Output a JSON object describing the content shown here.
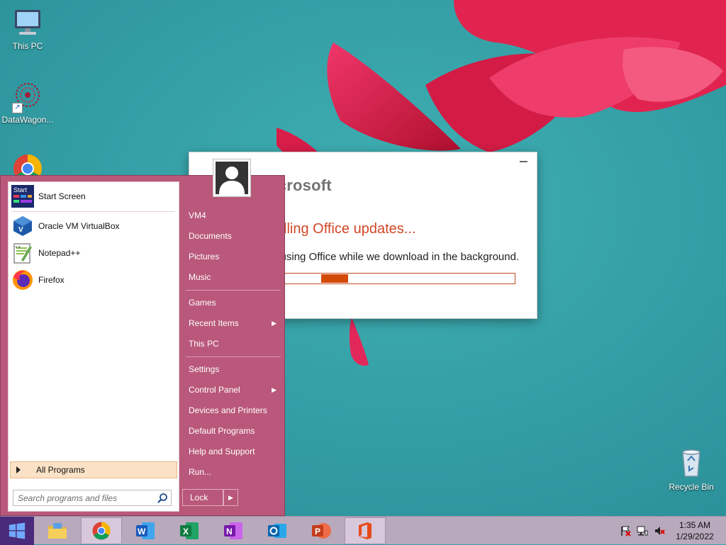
{
  "desktop": {
    "icons": [
      {
        "label": "This PC"
      },
      {
        "label": "DataWagon..."
      },
      {
        "label": "Recycle Bin"
      }
    ]
  },
  "office_dialog": {
    "brand": "Microsoft",
    "title": "We're installing Office updates...",
    "message": "You can keep using Office while we download in the background.",
    "progress_fraction": 0.09,
    "accent_color": "#d24726"
  },
  "start_menu": {
    "programs": [
      {
        "label": "Start Screen",
        "icon": "start-screen-icon"
      },
      {
        "label": "Oracle VM VirtualBox",
        "icon": "virtualbox-icon"
      },
      {
        "label": "Notepad++",
        "icon": "notepad-plus-plus-icon"
      },
      {
        "label": "Firefox",
        "icon": "firefox-icon"
      }
    ],
    "all_programs_label": "All Programs",
    "search_placeholder": "Search programs and files",
    "right_links": [
      {
        "label": "VM4"
      },
      {
        "label": "Documents"
      },
      {
        "label": "Pictures"
      },
      {
        "label": "Music"
      },
      {
        "label": "Games"
      },
      {
        "label": "Recent Items",
        "submenu": true
      },
      {
        "label": "This PC"
      },
      {
        "label": "Settings"
      },
      {
        "label": "Control Panel",
        "submenu": true
      },
      {
        "label": "Devices and Printers"
      },
      {
        "label": "Default Programs"
      },
      {
        "label": "Help and Support"
      },
      {
        "label": "Run..."
      }
    ],
    "lock_label": "Lock",
    "menu_color": "#b9587a"
  },
  "taskbar": {
    "apps": [
      {
        "name": "file-explorer",
        "active": false
      },
      {
        "name": "chrome",
        "active": true
      },
      {
        "name": "word",
        "active": false
      },
      {
        "name": "excel",
        "active": false
      },
      {
        "name": "onenote",
        "active": false
      },
      {
        "name": "outlook",
        "active": false
      },
      {
        "name": "powerpoint",
        "active": false
      },
      {
        "name": "office",
        "active": true
      }
    ],
    "clock_time": "1:35 AM",
    "clock_date": "1/29/2022"
  }
}
